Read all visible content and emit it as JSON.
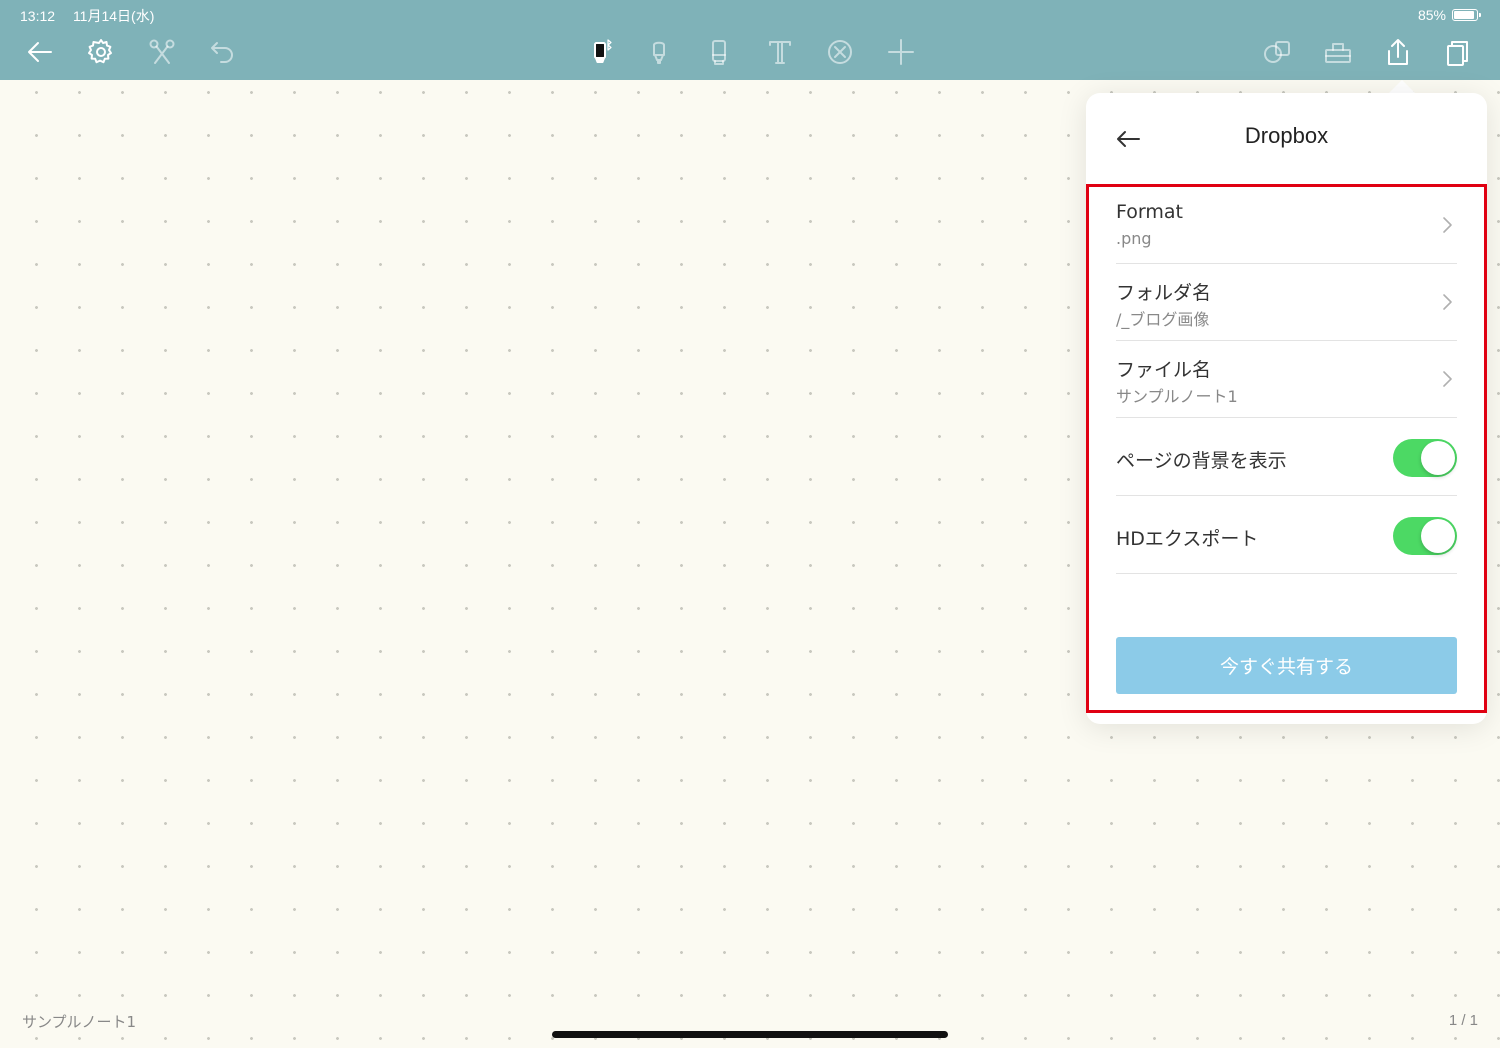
{
  "status_bar": {
    "time": "13:12",
    "date": "11月14日(水)",
    "battery": "85%"
  },
  "toolbar": {
    "left_icons": [
      "back-arrow-icon",
      "gear-icon",
      "scissors-icon",
      "undo-icon"
    ],
    "center_icons": [
      "pen-bluetooth-icon",
      "highlighter-icon",
      "eraser-icon",
      "text-icon",
      "cross-circle-icon",
      "plus-icon"
    ],
    "right_icons": [
      "shapes-icon",
      "toolbox-icon",
      "share-icon",
      "pages-icon"
    ],
    "color": "#7fb2b8"
  },
  "popover": {
    "title": "Dropbox",
    "rows": [
      {
        "label": "Format",
        "value": ".png"
      },
      {
        "label": "フォルダ名",
        "value": "/_ブログ画像"
      },
      {
        "label": "ファイル名",
        "value": "サンプルノート1"
      }
    ],
    "toggles": [
      {
        "label": "ページの背景を表示",
        "on": true
      },
      {
        "label": "HDエクスポート",
        "on": true
      }
    ],
    "share_button": "今すぐ共有する",
    "toggle_color": "#4cd964",
    "button_color": "#8ccbe8",
    "highlight_color": "#e00012"
  },
  "footer": {
    "note_name": "サンプルノート1",
    "page": "1 / 1"
  }
}
